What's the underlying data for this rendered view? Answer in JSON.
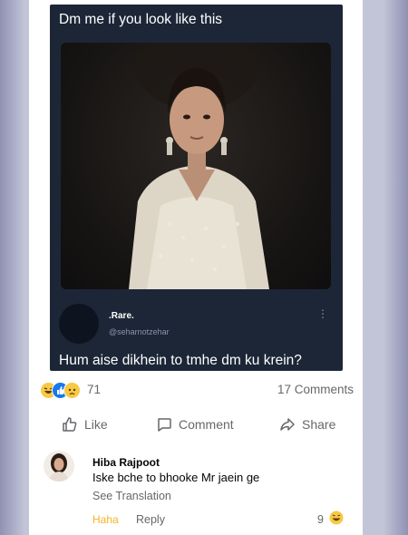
{
  "post": {
    "caption": "Dm me if you look like this",
    "tweet": {
      "name": ".Rare.",
      "handle": "@seharnotzehar",
      "more": "⋮",
      "text": "Hum aise dikhein to tmhe dm ku krein?"
    }
  },
  "stats": {
    "reactions": [
      "haha",
      "like",
      "sad"
    ],
    "reaction_count": "71",
    "comments": "17 Comments"
  },
  "actions": {
    "like": "Like",
    "comment": "Comment",
    "share": "Share"
  },
  "comment": {
    "author": "Hiba Rajpoot",
    "text": "Iske bche to bhooke Mr jaein ge",
    "see_translation": "See Translation",
    "reaction_label": "Haha",
    "reply": "Reply",
    "reaction_count": "9"
  },
  "colors": {
    "post_bg": "#1c2637",
    "fb_blue": "#1877f2",
    "haha_orange": "#f7b125",
    "muted": "#65676b"
  }
}
